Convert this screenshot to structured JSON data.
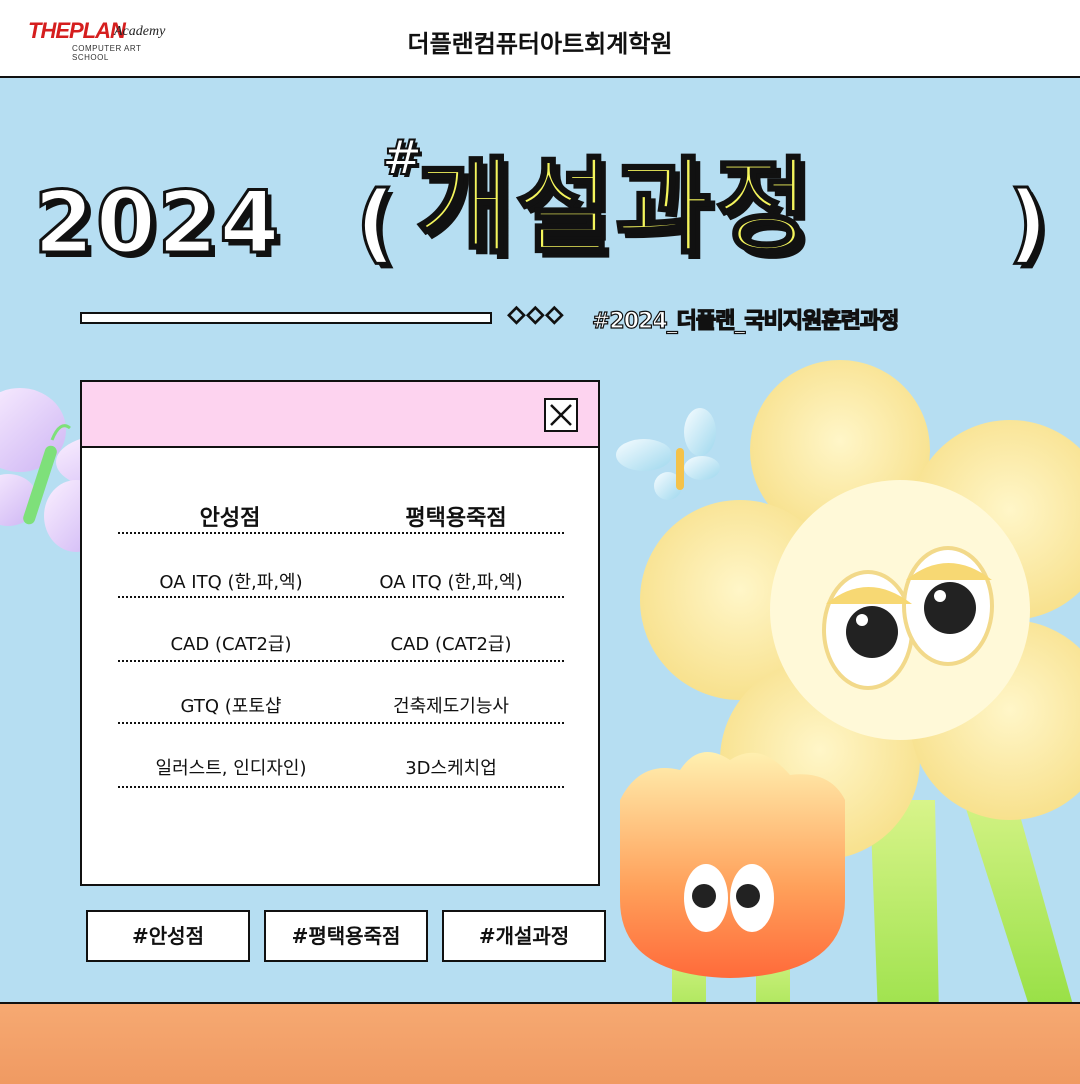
{
  "header": {
    "logo_main": "THEPLAN",
    "logo_academy": "Academy",
    "logo_sub": "COMPUTER ART SCHOOL",
    "brand_title": "더플랜컴퓨터아트회계학원"
  },
  "hero": {
    "year": "2024",
    "paren_open": "(",
    "paren_close": ")",
    "hash": "#",
    "headline": "개설과정",
    "diamonds": "◇◇◇",
    "tagline": "#2024_더플랜_국비지원훈련과정"
  },
  "window": {
    "columns": [
      "안성점",
      "평택용죽점"
    ],
    "rows": [
      [
        "OA ITQ (한,파,엑)",
        "OA ITQ (한,파,엑)"
      ],
      [
        "CAD (CAT2급)",
        "CAD (CAT2급)"
      ],
      [
        "GTQ (포토샵",
        "건축제도기능사"
      ],
      [
        "일러스트, 인디자인)",
        "3D스케치업"
      ]
    ]
  },
  "tags": [
    "#안성점",
    "#평택용죽점",
    "#개설과정"
  ],
  "colors": {
    "background": "#b6def2",
    "headline_fill": "#f4f55c",
    "window_titlebar": "#fdd3ef",
    "ground": "#f6a972",
    "brand_red": "#d51e1e"
  },
  "icons": [
    "close-icon",
    "butterfly-icon",
    "flower-character-icon",
    "tulip-character-icon"
  ]
}
